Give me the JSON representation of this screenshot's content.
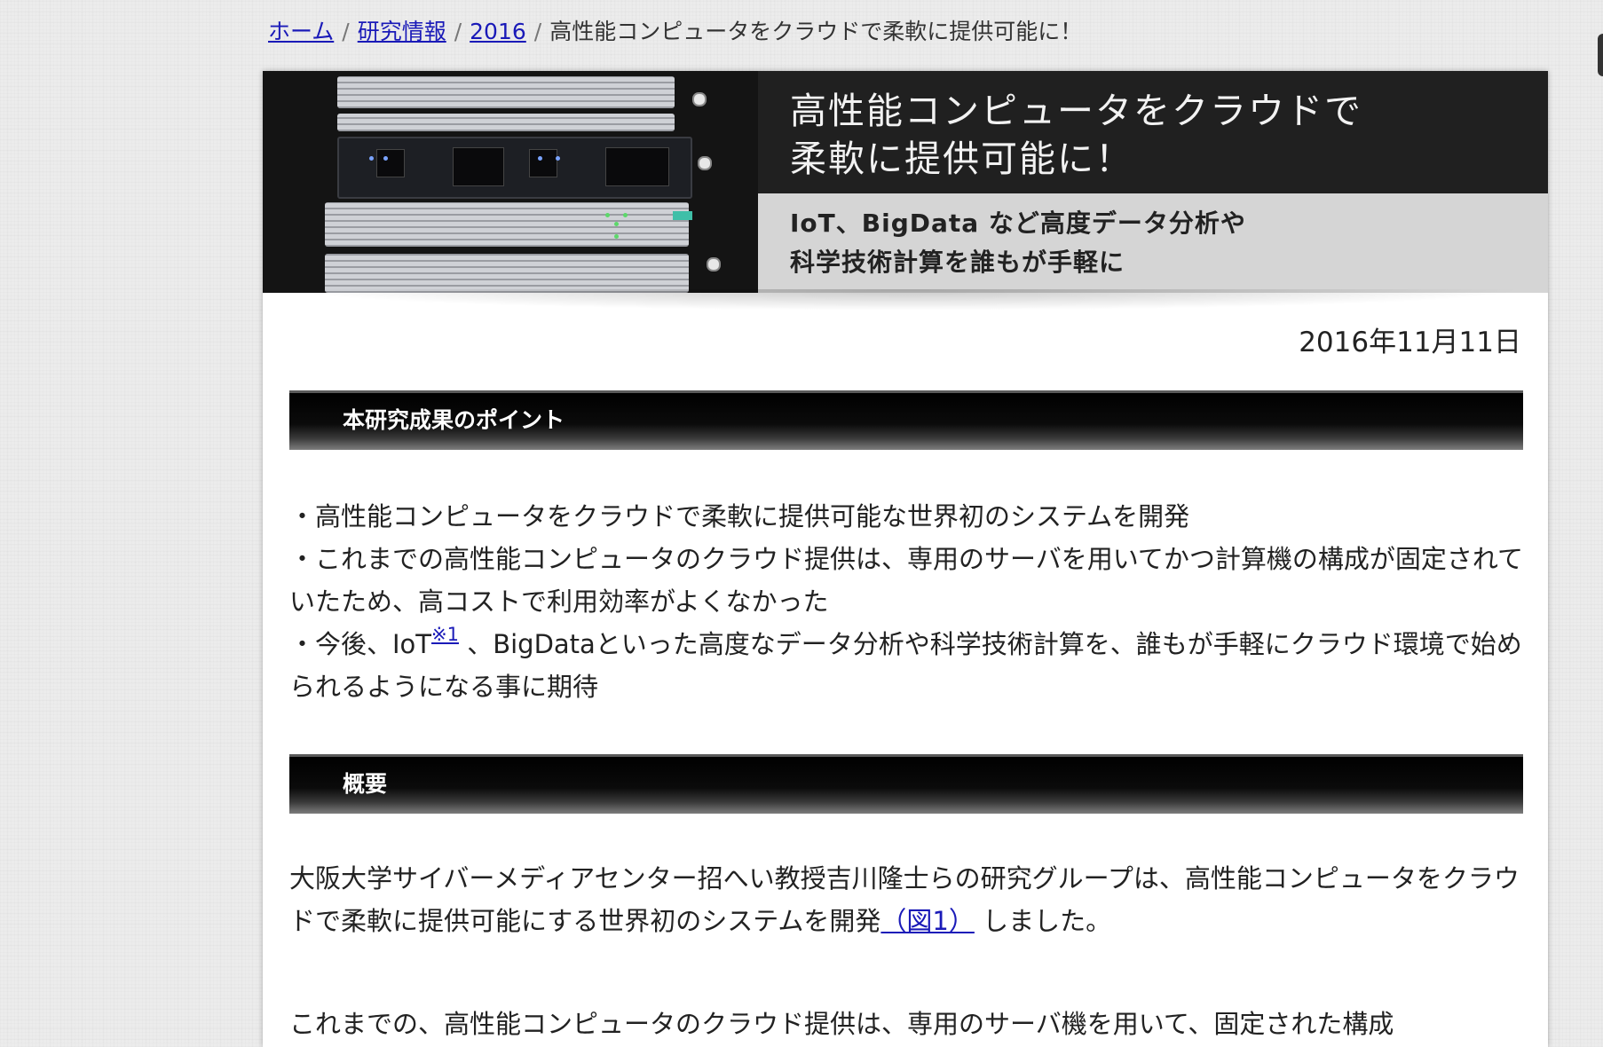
{
  "breadcrumb": {
    "home": "ホーム",
    "research": "研究情報",
    "year": "2016",
    "current": "高性能コンピュータをクラウドで柔軟に提供可能に！",
    "separator": "/"
  },
  "banner": {
    "title": "高性能コンピュータをクラウドで\n柔軟に提供可能に！",
    "subtitle": "IoT、BigData など高度データ分析や\n科学技術計算を誰もが手軽に"
  },
  "article": {
    "date": "2016年11月11日",
    "points_heading": "本研究成果のポイント",
    "point1": "・高性能コンピュータをクラウドで柔軟に提供可能な世界初のシステムを開発",
    "point2": "・これまでの高性能コンピュータのクラウド提供は、専用のサーバを用いてかつ計算機の構成が固定されていたため、高コストで利用効率がよくなかった",
    "point3_prefix": "・今後、IoT",
    "point3_note": "※1",
    "point3_suffix": " 、BigDataといった高度なデータ分析や科学技術計算を、誰もが手軽にクラウド環境で始められるようになる事に期待",
    "overview_heading": "概要",
    "overview_prefix": "大阪大学サイバーメディアセンター招へい教授吉川隆士らの研究グループは、高性能コンピュータをクラウドで柔軟に提供可能にする世界初のシステムを開発",
    "overview_link": "（図1）",
    "overview_suffix": " しました。",
    "overview_next": "これまでの、高性能コンピュータのクラウド提供は、専用のサーバ機を用いて、固定された構成"
  },
  "colors": {
    "link": "#1a1ab8",
    "section_bar": "#000000",
    "page_background": "#ececec"
  }
}
